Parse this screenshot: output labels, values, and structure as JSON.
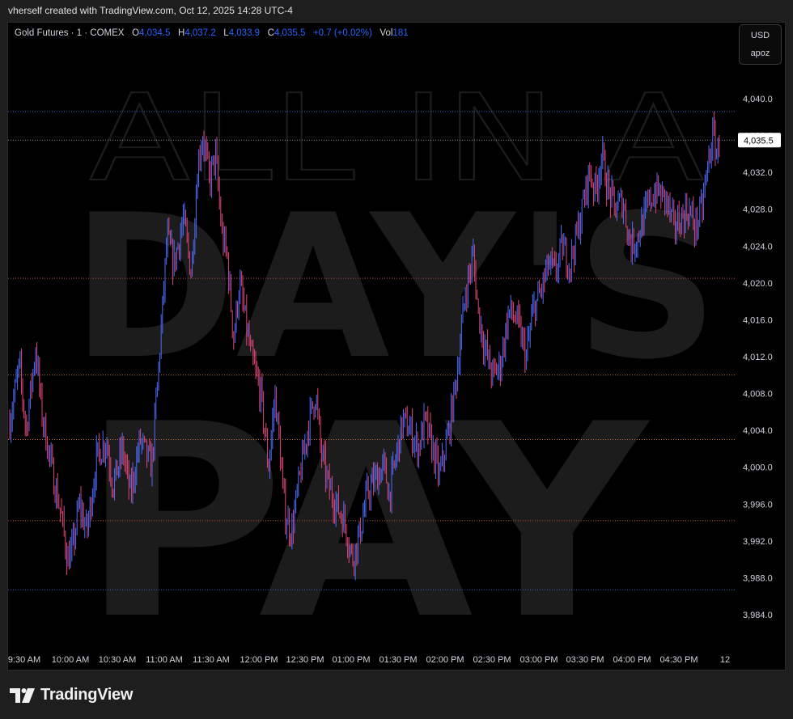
{
  "header": {
    "created_text": "vherself created with TradingView.com, Oct 12, 2025 14:28 UTC-4"
  },
  "legend": {
    "symbol": "Gold Futures · 1 · COMEX",
    "open_label": "O",
    "open": "4,034.5",
    "high_label": "H",
    "high": "4,037.2",
    "low_label": "L",
    "low": "4,033.9",
    "close_label": "C",
    "close": "4,035.5",
    "change": "+0.7 (+0.02%)",
    "vol_label": "Vol",
    "vol": "181"
  },
  "currency": {
    "code": "USD",
    "sub": "apoz"
  },
  "watermark": {
    "line1": "ALL IN A",
    "line2": "DAY'S",
    "line3": "PAY"
  },
  "brand": {
    "name": "TradingView"
  },
  "colors": {
    "up": "#4d6dff",
    "down": "#e0457a",
    "line_blue": "#3f5ccf",
    "line_red": "#b8473c",
    "line_orange": "#c46f3a",
    "line_gray": "#9a9a9a",
    "price_label_bg": "#ffffff"
  },
  "chart_data": {
    "type": "ohlc",
    "instrument": "Gold Futures",
    "interval": "1",
    "exchange": "COMEX",
    "ylim": [
      3982,
      4042
    ],
    "yticks": [
      4040,
      4036,
      4032,
      4028,
      4024,
      4020,
      4016,
      4012,
      4008,
      4004,
      4000,
      3996,
      3992,
      3988,
      3984
    ],
    "ytick_labels": [
      "4,040.0",
      "4,036.0",
      "4,032.0",
      "4,028.0",
      "4,024.0",
      "4,020.0",
      "4,016.0",
      "4,012.0",
      "4,008.0",
      "4,004.0",
      "4,000.0",
      "3,996.0",
      "3,992.0",
      "3,988.0",
      "3,984.0"
    ],
    "xlim": [
      9.5,
      16.9
    ],
    "xticks": [
      9.5,
      10.0,
      10.5,
      11.0,
      11.5,
      12.0,
      12.5,
      13.0,
      13.5,
      14.0,
      14.5,
      15.0,
      15.5,
      16.0,
      16.5,
      16.9
    ],
    "xtick_labels": [
      "9:30 AM",
      "10:00 AM",
      "10:30 AM",
      "11:00 AM",
      "11:30 AM",
      "12:00 PM",
      "12:30 PM",
      "01:00 PM",
      "01:30 PM",
      "02:00 PM",
      "02:30 PM",
      "03:00 PM",
      "03:30 PM",
      "04:00 PM",
      "04:30 PM",
      "12"
    ],
    "current_price": 4035.5,
    "current_price_label": "4,035.5",
    "horizontal_levels": [
      {
        "value": 4038.6,
        "color": "blue"
      },
      {
        "value": 4035.5,
        "color": "gray"
      },
      {
        "value": 4020.5,
        "color": "red"
      },
      {
        "value": 4010.0,
        "color": "orange"
      },
      {
        "value": 4003.0,
        "color": "orange"
      },
      {
        "value": 3994.2,
        "color": "red"
      },
      {
        "value": 3986.7,
        "color": "blue"
      }
    ],
    "path": [
      [
        9.5,
        4005
      ],
      [
        9.6,
        4011
      ],
      [
        9.67,
        4004
      ],
      [
        9.77,
        4013
      ],
      [
        9.83,
        4006
      ],
      [
        9.95,
        3999
      ],
      [
        10.03,
        3995
      ],
      [
        10.1,
        3990
      ],
      [
        10.15,
        3991
      ],
      [
        10.22,
        3996
      ],
      [
        10.3,
        3993
      ],
      [
        10.4,
        4001
      ],
      [
        10.5,
        4003
      ],
      [
        10.57,
        3998
      ],
      [
        10.67,
        4002
      ],
      [
        10.75,
        3997
      ],
      [
        10.85,
        4003
      ],
      [
        10.97,
        4000
      ],
      [
        11.05,
        4012
      ],
      [
        11.13,
        4025
      ],
      [
        11.2,
        4022
      ],
      [
        11.3,
        4027
      ],
      [
        11.38,
        4021
      ],
      [
        11.45,
        4033
      ],
      [
        11.5,
        4036
      ],
      [
        11.57,
        4031
      ],
      [
        11.63,
        4034
      ],
      [
        11.7,
        4025
      ],
      [
        11.75,
        4023
      ],
      [
        11.82,
        4014
      ],
      [
        11.88,
        4020
      ],
      [
        12.0,
        4012
      ],
      [
        12.1,
        4008
      ],
      [
        12.18,
        4000
      ],
      [
        12.25,
        4008
      ],
      [
        12.35,
        3995
      ],
      [
        12.42,
        3993
      ],
      [
        12.52,
        4000
      ],
      [
        12.6,
        4005
      ],
      [
        12.67,
        4008
      ],
      [
        12.72,
        4002
      ],
      [
        12.8,
        3998
      ],
      [
        12.88,
        3996
      ],
      [
        12.97,
        3994
      ],
      [
        13.05,
        3990
      ],
      [
        13.13,
        3993
      ],
      [
        13.2,
        3997
      ],
      [
        13.3,
        3999
      ],
      [
        13.38,
        4000
      ],
      [
        13.43,
        3997
      ],
      [
        13.5,
        4001
      ],
      [
        13.57,
        4005
      ],
      [
        13.65,
        4004
      ],
      [
        13.73,
        4002
      ],
      [
        13.8,
        4005
      ],
      [
        13.88,
        4002
      ],
      [
        13.95,
        3999
      ],
      [
        14.05,
        4004
      ],
      [
        14.13,
        4010
      ],
      [
        14.22,
        4019
      ],
      [
        14.3,
        4023
      ],
      [
        14.35,
        4017
      ],
      [
        14.42,
        4013
      ],
      [
        14.5,
        4010
      ],
      [
        14.58,
        4011
      ],
      [
        14.67,
        4017
      ],
      [
        14.75,
        4016
      ],
      [
        14.85,
        4012
      ],
      [
        14.92,
        4017
      ],
      [
        15.0,
        4019
      ],
      [
        15.08,
        4022
      ],
      [
        15.15,
        4021
      ],
      [
        15.22,
        4024
      ],
      [
        15.3,
        4022
      ],
      [
        15.37,
        4025
      ],
      [
        15.43,
        4028
      ],
      [
        15.5,
        4032
      ],
      [
        15.57,
        4030
      ],
      [
        15.63,
        4034
      ],
      [
        15.7,
        4030
      ],
      [
        15.77,
        4028
      ],
      [
        15.85,
        4029
      ],
      [
        15.93,
        4024
      ],
      [
        16.0,
        4025
      ],
      [
        16.07,
        4027
      ],
      [
        16.13,
        4029
      ],
      [
        16.2,
        4030
      ],
      [
        16.3,
        4029
      ],
      [
        16.38,
        4026
      ],
      [
        16.45,
        4027
      ],
      [
        16.53,
        4028
      ],
      [
        16.6,
        4026
      ],
      [
        16.67,
        4028
      ],
      [
        16.72,
        4032
      ],
      [
        16.78,
        4036
      ],
      [
        16.83,
        4034
      ],
      [
        16.86,
        4035.5
      ]
    ]
  }
}
